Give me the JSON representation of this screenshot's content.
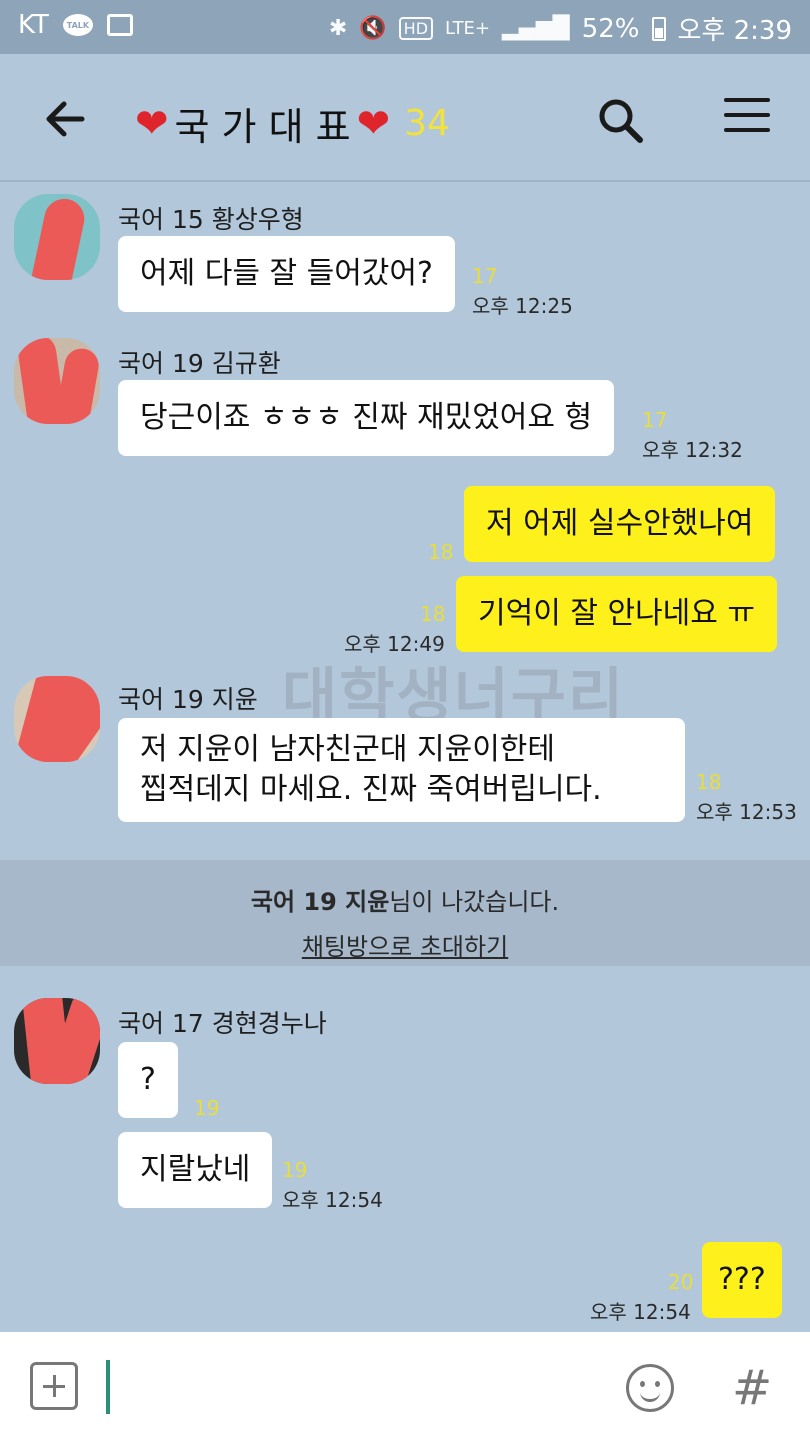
{
  "status_bar": {
    "carrier": "KT",
    "talk_icon_label": "TALK",
    "network": "LTE+",
    "battery": "52%",
    "time": "오후 2:39"
  },
  "header": {
    "title": "국 가 대 표",
    "member_count": "34"
  },
  "messages": [
    {
      "sender": "국어 15 황상우형",
      "text": "어제 다들 잘 들어갔어?",
      "unread": "17",
      "time": "오후 12:25"
    },
    {
      "sender": "국어 19 김규환",
      "text": "당근이죠 ㅎㅎㅎ 진짜 재밌었어요 형",
      "unread": "17",
      "time": "오후 12:32"
    },
    {
      "sender": "me",
      "text": "저 어제 실수안했나여",
      "unread": "18",
      "time": ""
    },
    {
      "sender": "me",
      "text": "기억이 잘 안나네요 ㅠ",
      "unread": "18",
      "time": "오후 12:49"
    },
    {
      "sender": "국어 19 지윤",
      "line1": "저 지윤이 남자친군대 지윤이한테",
      "line2": "찝적데지 마세요. 진짜 죽여버립니다.",
      "unread": "18",
      "time": "오후 12:53"
    },
    {
      "sender": "국어 17 경현경누나",
      "text": "?",
      "unread": "19",
      "time": ""
    },
    {
      "sender": "국어 17 경현경누나",
      "text": "지랄났네",
      "unread": "19",
      "time": "오후 12:54"
    },
    {
      "sender": "me",
      "text": "???",
      "unread": "20",
      "time": "오후 12:54"
    }
  ],
  "system_notice": {
    "name": "국어 19 지윤",
    "suffix": "님이 나갔습니다.",
    "invite_link": "채팅방으로 초대하기"
  },
  "watermark": "대학생너구리"
}
